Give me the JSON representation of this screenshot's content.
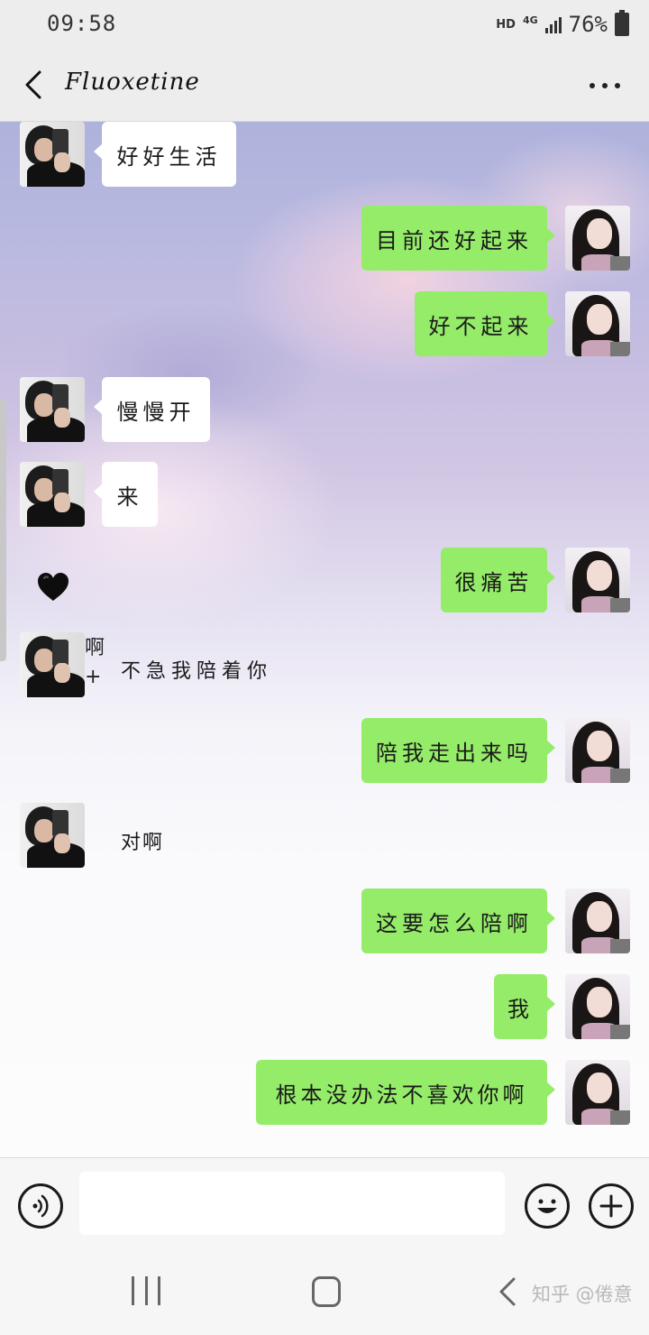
{
  "status_bar": {
    "time": "09:58",
    "hd": "HD",
    "network": "4G",
    "battery_percent": "76%"
  },
  "header": {
    "title": "Fluoxetine",
    "back_icon": "chevron-left-icon",
    "more_icon": "more-horizontal-icon"
  },
  "messages": [
    {
      "side": "left",
      "text": "好好生活"
    },
    {
      "side": "right",
      "text": "目前还好起来"
    },
    {
      "side": "right",
      "text": "好不起来"
    },
    {
      "side": "left",
      "text": "慢慢开"
    },
    {
      "side": "left",
      "text": "来"
    },
    {
      "side": "left",
      "emoji": "black-heart-icon"
    },
    {
      "side": "right",
      "text": "很痛苦"
    },
    {
      "side": "left",
      "side_chars": [
        "啊",
        "+"
      ],
      "text": "不急我陪着你"
    },
    {
      "side": "right",
      "text": "陪我走出来吗"
    },
    {
      "side": "left",
      "text": "对啊"
    },
    {
      "side": "right",
      "text": "这要怎么陪啊"
    },
    {
      "side": "right",
      "text": "我"
    },
    {
      "side": "right",
      "text": "根本没办法不喜欢你啊"
    }
  ],
  "input_bar": {
    "voice_icon": "voice-icon",
    "input_value": "",
    "emoji_icon": "emoji-icon",
    "add_icon": "plus-circle-icon"
  },
  "nav_bar": {
    "recent_icon": "recent-apps-icon",
    "home_icon": "home-icon",
    "back_icon": "back-icon"
  },
  "watermark": "知乎 @倦意",
  "colors": {
    "sent_bubble": "#95ec69",
    "received_bubble": "#ffffff",
    "bar_background": "#ededed"
  }
}
